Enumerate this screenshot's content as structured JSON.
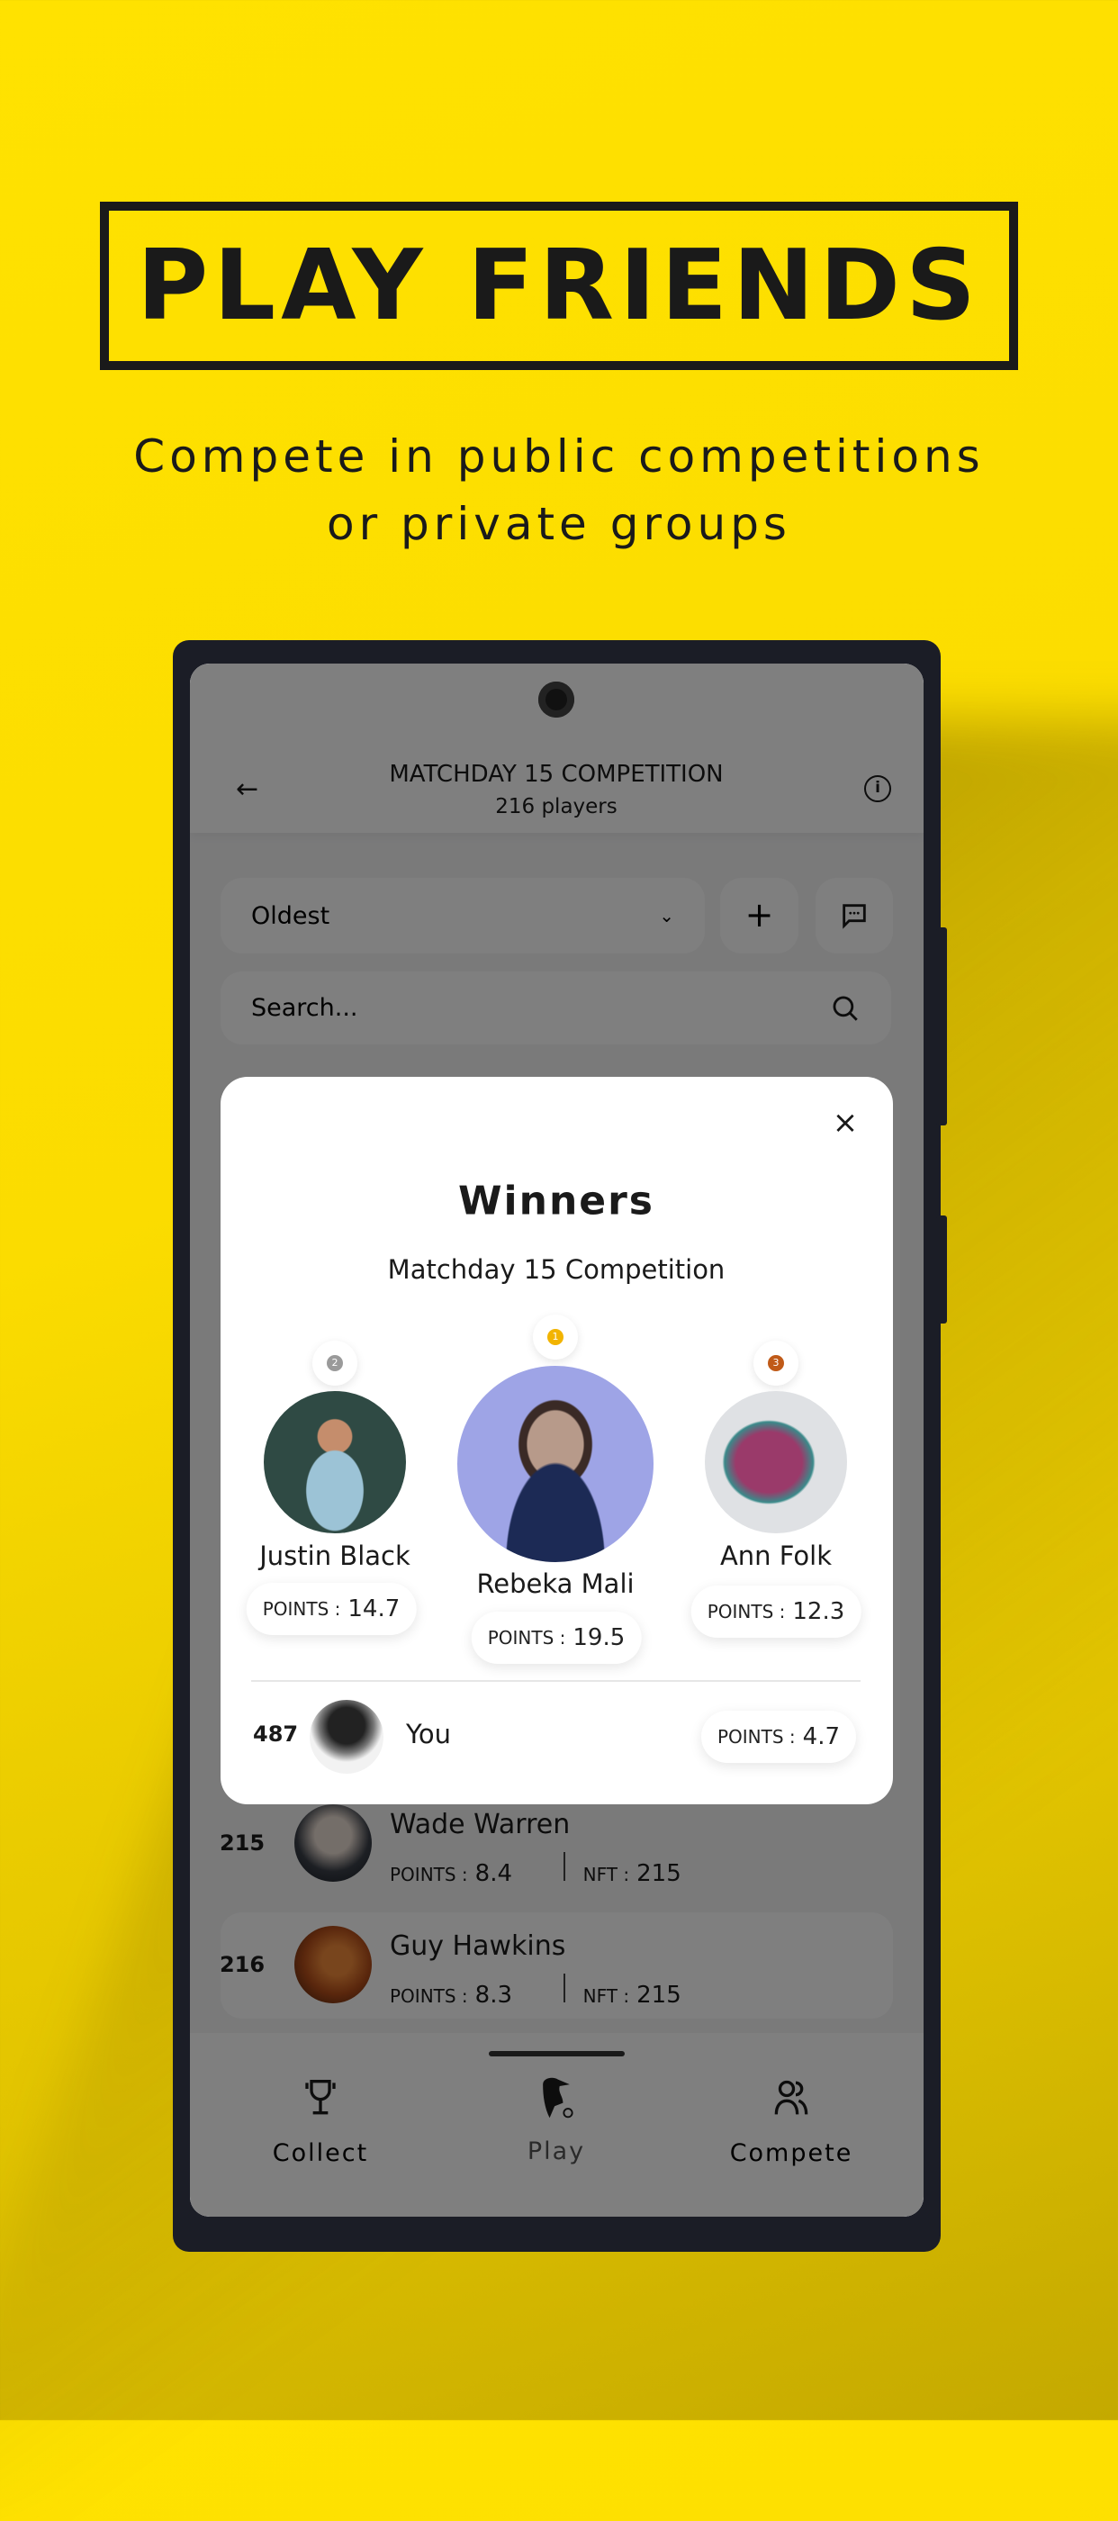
{
  "hero": {
    "title": "PLAY FRIENDS",
    "subtitle_line1": "Compete in public competitions",
    "subtitle_line2": "or private groups"
  },
  "header": {
    "title": "MATCHDAY 15 COMPETITION",
    "subtitle": "216 players"
  },
  "controls": {
    "sort_value": "Oldest",
    "search_placeholder": "Search..."
  },
  "modal": {
    "title": "Winners",
    "subtitle": "Matchday 15 Competition",
    "points_label": "POINTS :",
    "winners": [
      {
        "place": "2",
        "name": "Justin Black",
        "points": "14.7",
        "medal_color": "#9a9a9a"
      },
      {
        "place": "1",
        "name": "Rebeka Mali",
        "points": "19.5",
        "medal_color": "#f2b400"
      },
      {
        "place": "3",
        "name": "Ann Folk",
        "points": "12.3",
        "medal_color": "#c05a18"
      }
    ],
    "you": {
      "rank": "487",
      "name": "You",
      "points": "4.7"
    }
  },
  "list": [
    {
      "rank": "215",
      "name": "Wade Warren",
      "points_label": "POINTS :",
      "points": "8.4",
      "nft_label": "NFT :",
      "nft": "215"
    },
    {
      "rank": "216",
      "name": "Guy Hawkins",
      "points_label": "POINTS :",
      "points": "8.3",
      "nft_label": "NFT :",
      "nft": "215"
    }
  ],
  "nav": [
    {
      "label": "Collect",
      "icon": "trophy-icon"
    },
    {
      "label": "Play",
      "icon": "toucan-icon"
    },
    {
      "label": "Compete",
      "icon": "users-icon"
    }
  ]
}
